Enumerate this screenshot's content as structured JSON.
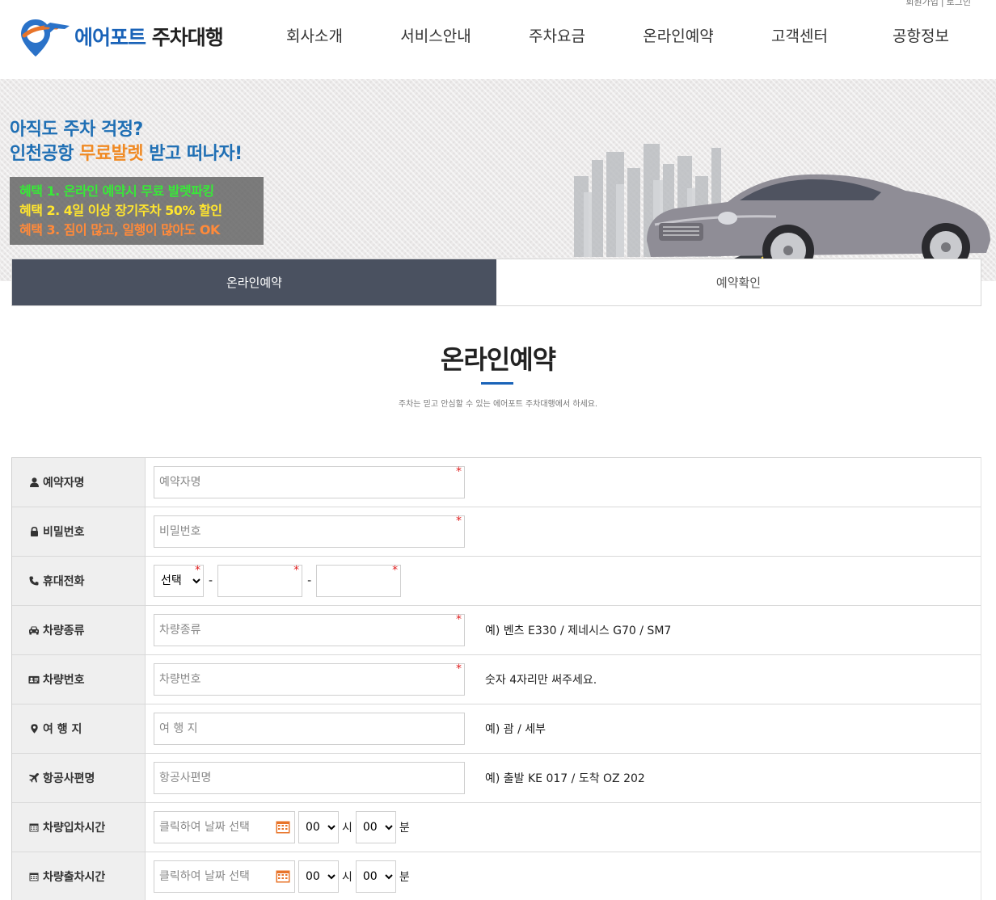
{
  "header": {
    "util_links": [
      "회원가입",
      "로그인"
    ],
    "logo_part1": "에어포트",
    "logo_part2": "주차대행",
    "nav": [
      "회사소개",
      "서비스안내",
      "주차요금",
      "온라인예약",
      "고객센터",
      "공항정보"
    ]
  },
  "banner": {
    "line1": "아직도 주차 걱정?",
    "line2_a": "인천공항 ",
    "line2_hl": "무료발렛",
    "line2_b": " 받고 떠나자!",
    "benefits": [
      "혜택 1. 온라인 예약시 무료 발렛파킹",
      "혜택 2. 4일 이상 장기주차 50% 할인",
      "혜택 3. 짐이 많고, 일행이 많아도 OK"
    ]
  },
  "tabs": {
    "active": "온라인예약",
    "inactive": "예약확인"
  },
  "section": {
    "title": "온라인예약",
    "subtitle": "주차는 믿고 안심할 수 있는 에어포트 주차대행에서 하세요."
  },
  "form": {
    "name": {
      "label": "예약자명",
      "placeholder": "예약자명"
    },
    "password": {
      "label": "비밀번호",
      "placeholder": "비밀번호"
    },
    "phone": {
      "label": "휴대전화",
      "select_value": "선택",
      "dash": "-"
    },
    "car_type": {
      "label": "차량종류",
      "placeholder": "차량종류",
      "hint": "예) 벤츠 E330 / 제네시스 G70 / SM7"
    },
    "car_number": {
      "label": "차량번호",
      "placeholder": "차량번호",
      "hint": "숫자 4자리만 써주세요."
    },
    "destination": {
      "label": "여 행 지",
      "placeholder": "여 행 지",
      "hint": "예) 괌 / 세부"
    },
    "flight": {
      "label": "항공사편명",
      "placeholder": "항공사편명",
      "hint": "예) 출발 KE 017 / 도착 OZ 202"
    },
    "checkin": {
      "label": "차량입차시간",
      "placeholder": "클릭하여 날짜 선택",
      "hour": "00",
      "hour_unit": "시",
      "minute": "00",
      "minute_unit": "분"
    },
    "checkout": {
      "label": "차량출차시간",
      "placeholder": "클릭하여 날짜 선택",
      "hour": "00",
      "hour_unit": "시",
      "minute": "00",
      "minute_unit": "분"
    },
    "required_mark": "*"
  },
  "colors": {
    "brand_blue": "#1a63b8",
    "tab_active_bg": "#4a5160",
    "required_red": "#e02020",
    "calendar_orange": "#e8742a"
  }
}
